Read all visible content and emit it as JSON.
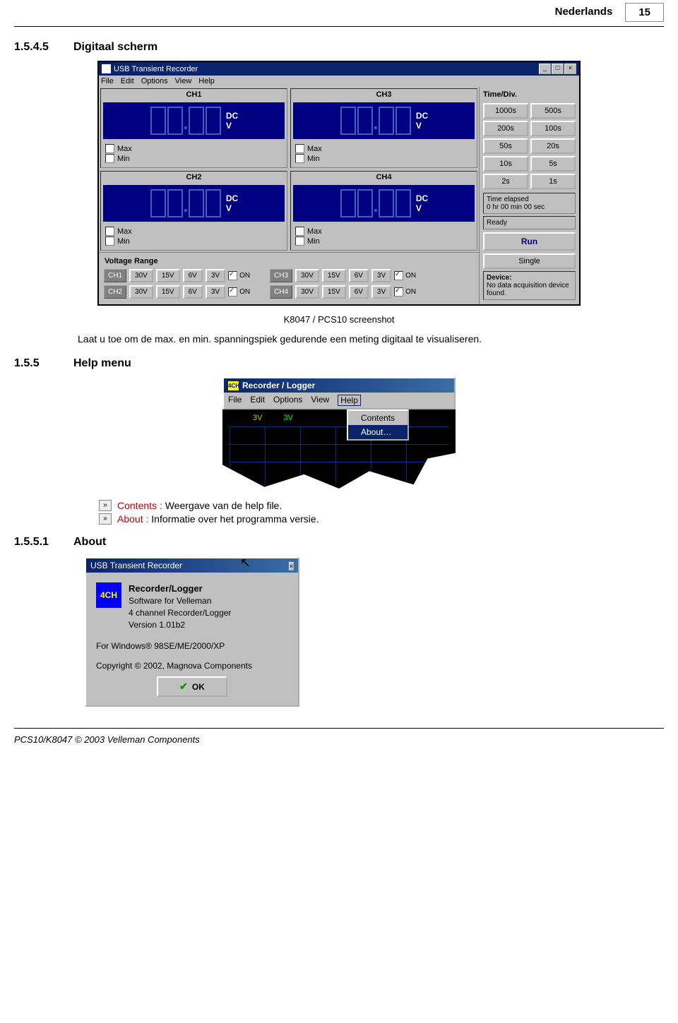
{
  "header": {
    "lang": "Nederlands",
    "page": "15"
  },
  "s1": {
    "num": "1.5.4.5",
    "title": "Digitaal scherm"
  },
  "app1": {
    "title": "USB Transient Recorder",
    "menu": [
      "File",
      "Edit",
      "Options",
      "View",
      "Help"
    ],
    "ch": [
      "CH1",
      "CH2",
      "CH3",
      "CH4"
    ],
    "dc": "DC",
    "v": "V",
    "max": "Max",
    "min": "Min",
    "side": {
      "hdr": "Time/Div.",
      "btns": [
        "1000s",
        "500s",
        "200s",
        "100s",
        "50s",
        "20s",
        "10s",
        "5s",
        "2s",
        "1s"
      ],
      "te_lbl": "Time elapsed",
      "te_val": "0 hr  00 min  00 sec",
      "ready": "Ready",
      "run": "Run",
      "single": "Single",
      "dev_lbl": "Device:",
      "dev_txt": "No data acquisition device found."
    },
    "vr": {
      "hdr": "Voltage Range",
      "ch": [
        "CH1",
        "CH2",
        "CH3",
        "CH4"
      ],
      "v": [
        "30V",
        "15V",
        "6V",
        "3V"
      ],
      "on": "ON"
    }
  },
  "caption": "K8047 / PCS10 screenshot",
  "desc": "Laat u toe om de max. en min. spanningspiek gedurende een meting digitaal te visualiseren.",
  "s2": {
    "num": "1.5.5",
    "title": "Help menu"
  },
  "app2": {
    "icon": "4CH",
    "title": "Recorder / Logger",
    "menu": [
      "File",
      "Edit",
      "Options",
      "View",
      "Help"
    ],
    "dd": [
      "Contents",
      "About…"
    ],
    "pl": [
      "3V",
      "3V"
    ]
  },
  "bul": {
    "k1": "Contents :",
    "t1": " Weergave van de help file.",
    "k2": "About :",
    "t2": " Informatie over het programma versie."
  },
  "s3": {
    "num": "1.5.5.1",
    "title": "About"
  },
  "app3": {
    "title": "USB Transient Recorder",
    "icon": "4CH",
    "h": "Recorder/Logger",
    "l1": "Software for Velleman",
    "l2": "4 channel Recorder/Logger",
    "l3": "Version 1.01b2",
    "l4": "For Windows® 98SE/ME/2000/XP",
    "l5": "Copyright © 2002, Magnova Components",
    "ok": "OK"
  },
  "footer": "PCS10/K8047 © 2003 Velleman Components"
}
